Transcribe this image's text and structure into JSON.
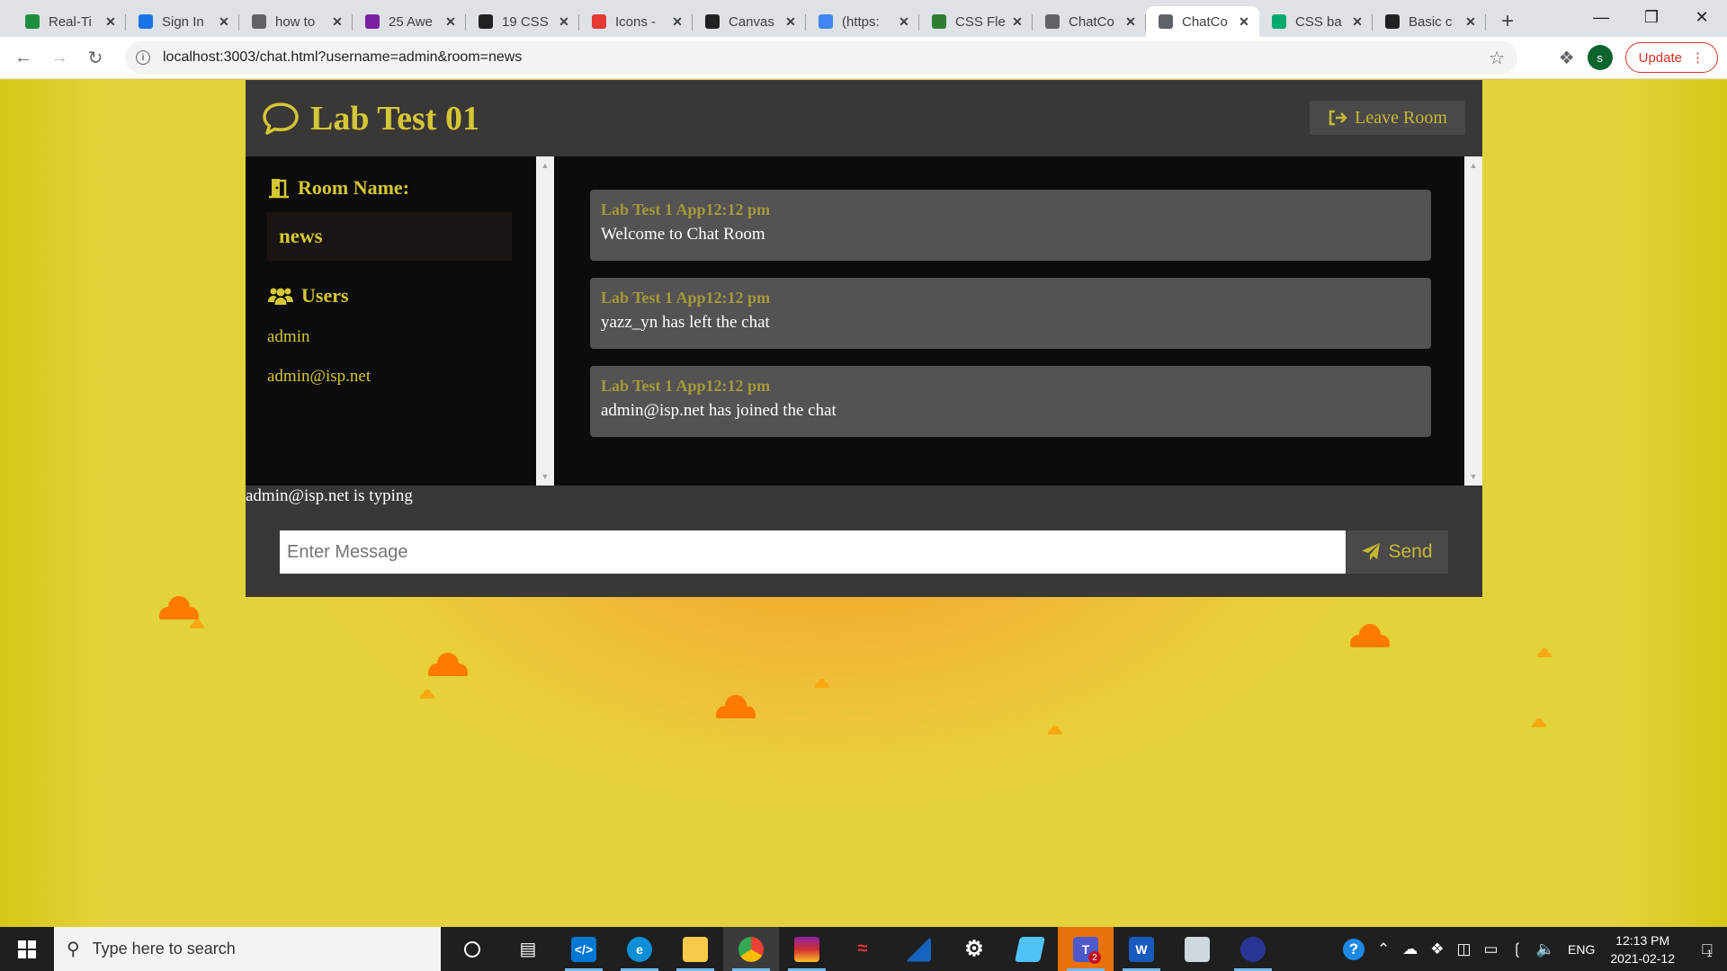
{
  "browser": {
    "tabs": [
      {
        "title": "Real-Ti",
        "icon": "leaf-icon",
        "color": "#1e8e3e"
      },
      {
        "title": "Sign In",
        "icon": "flag-icon",
        "color": "#1a73e8"
      },
      {
        "title": "how to",
        "icon": "hacker-icon",
        "color": "#5f6368"
      },
      {
        "title": "25 Awe",
        "icon": "bars-icon",
        "color": "#7b1fa2"
      },
      {
        "title": "19 CSS",
        "icon": "f-icon",
        "color": "#202124"
      },
      {
        "title": "Icons -",
        "icon": "m-icon",
        "color": "#e53935"
      },
      {
        "title": "Canvas",
        "icon": "codepen-icon",
        "color": "#202124"
      },
      {
        "title": "(https:",
        "icon": "google-icon",
        "color": "#4285f4"
      },
      {
        "title": "CSS Fle",
        "icon": "link-icon",
        "color": "#2e7d32"
      },
      {
        "title": "ChatCo",
        "icon": "globe-icon",
        "color": "#5f6368"
      },
      {
        "title": "ChatCo",
        "icon": "globe-icon",
        "color": "#5f6368",
        "active": true
      },
      {
        "title": "CSS ba",
        "icon": "w3-icon",
        "color": "#04aa6d"
      },
      {
        "title": "Basic c",
        "icon": "codepen-icon",
        "color": "#202124"
      }
    ],
    "url": "localhost:3003/chat.html?username=admin&room=news",
    "profile_initial": "s",
    "update_label": "Update"
  },
  "chat": {
    "title": "Lab Test 01",
    "leave_label": "Leave Room",
    "room_heading": "Room Name:",
    "room_name": "news",
    "users_heading": "Users",
    "users": [
      "admin",
      "admin@isp.net"
    ],
    "messages": [
      {
        "meta": "Lab Test 1 App12:12 pm",
        "text": "Welcome to Chat Room"
      },
      {
        "meta": "Lab Test 1 App12:12 pm",
        "text": "yazz_yn has left the chat"
      },
      {
        "meta": "Lab Test 1 App12:12 pm",
        "text": "admin@isp.net has joined the chat"
      }
    ],
    "typing": "admin@isp.net is typing",
    "input_placeholder": "Enter Message",
    "send_label": "Send",
    "colors": {
      "accent": "#d4c734",
      "panel": "#3a3737",
      "dark": "#0d0c0c",
      "bubble": "#545252"
    }
  },
  "taskbar": {
    "search_placeholder": "Type here to search",
    "language": "ENG",
    "time": "12:13 PM",
    "date": "2021-02-12",
    "teams_badge": "2",
    "notif_count": "1"
  }
}
